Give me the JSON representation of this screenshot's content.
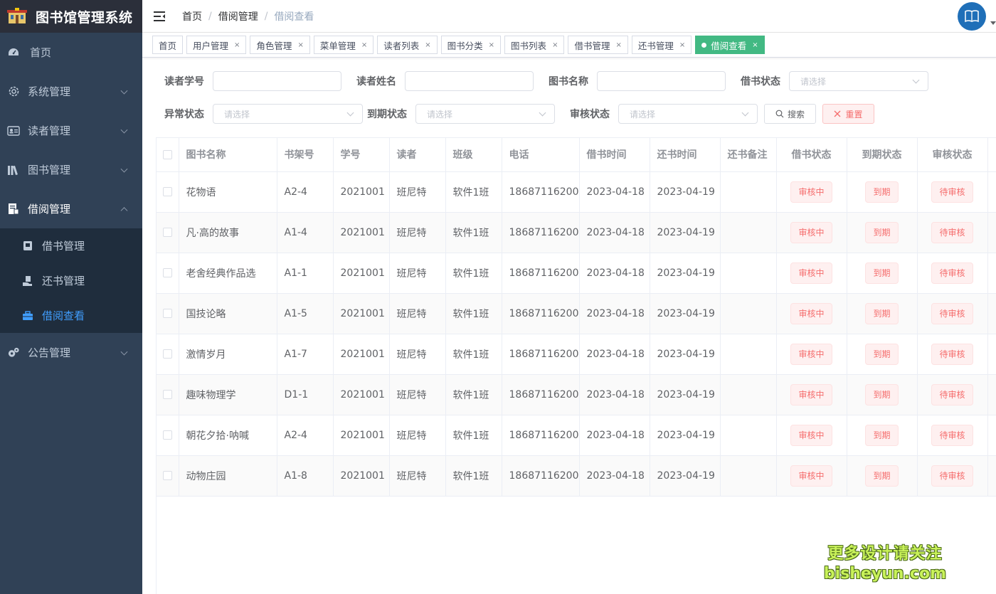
{
  "app": {
    "title": "图书馆管理系统"
  },
  "sidebar": {
    "items": [
      {
        "label": "首页",
        "icon": "dashboard-icon"
      },
      {
        "label": "系统管理",
        "icon": "gear-icon"
      },
      {
        "label": "读者管理",
        "icon": "id-card-icon"
      },
      {
        "label": "图书管理",
        "icon": "books-icon"
      },
      {
        "label": "借阅管理",
        "icon": "document-icon"
      },
      {
        "label": "公告管理",
        "icon": "cogs-icon"
      }
    ],
    "sub": [
      {
        "label": "借书管理",
        "icon": "book-icon"
      },
      {
        "label": "还书管理",
        "icon": "hand-icon"
      },
      {
        "label": "借阅查看",
        "icon": "briefcase-icon"
      }
    ]
  },
  "navbar": {
    "breadcrumb": [
      "首页",
      "借阅管理",
      "借阅查看"
    ],
    "sep": "/"
  },
  "tags": [
    {
      "label": "首页",
      "closable": false
    },
    {
      "label": "用户管理",
      "closable": true
    },
    {
      "label": "角色管理",
      "closable": true
    },
    {
      "label": "菜单管理",
      "closable": true
    },
    {
      "label": "读者列表",
      "closable": true
    },
    {
      "label": "图书分类",
      "closable": true
    },
    {
      "label": "图书列表",
      "closable": true
    },
    {
      "label": "借书管理",
      "closable": true
    },
    {
      "label": "还书管理",
      "closable": true
    },
    {
      "label": "借阅查看",
      "closable": true,
      "active": true
    }
  ],
  "close_glyph": "×",
  "form": {
    "reader_no": "读者学号",
    "reader_name": "读者姓名",
    "book_name": "图书名称",
    "borrow_status": "借书状态",
    "abnormal_status": "异常状态",
    "due_status": "到期状态",
    "audit_status": "审核状态",
    "placeholder": "请选择",
    "search_btn": "搜索",
    "reset_btn": "重置"
  },
  "table": {
    "headers": [
      "图书名称",
      "书架号",
      "学号",
      "读者",
      "班级",
      "电话",
      "借书时间",
      "还书时间",
      "还书备注",
      "借书状态",
      "到期状态",
      "审核状态"
    ],
    "rows": [
      {
        "book": "花物语",
        "shelf": "A2-4",
        "no": "2021001",
        "reader": "班尼特",
        "cls": "软件1班",
        "phone": "18687116200",
        "borrow": "2023-04-18",
        "ret": "2023-04-19",
        "note": "",
        "s1": "审核中",
        "s2": "到期",
        "s3": "待审核"
      },
      {
        "book": "凡·高的故事",
        "shelf": "A1-4",
        "no": "2021001",
        "reader": "班尼特",
        "cls": "软件1班",
        "phone": "18687116200",
        "borrow": "2023-04-18",
        "ret": "2023-04-19",
        "note": "",
        "s1": "审核中",
        "s2": "到期",
        "s3": "待审核"
      },
      {
        "book": "老舍经典作品选",
        "shelf": "A1-1",
        "no": "2021001",
        "reader": "班尼特",
        "cls": "软件1班",
        "phone": "18687116200",
        "borrow": "2023-04-18",
        "ret": "2023-04-19",
        "note": "",
        "s1": "审核中",
        "s2": "到期",
        "s3": "待审核"
      },
      {
        "book": "国技论略",
        "shelf": "A1-5",
        "no": "2021001",
        "reader": "班尼特",
        "cls": "软件1班",
        "phone": "18687116200",
        "borrow": "2023-04-18",
        "ret": "2023-04-19",
        "note": "",
        "s1": "审核中",
        "s2": "到期",
        "s3": "待审核"
      },
      {
        "book": "激情岁月",
        "shelf": "A1-7",
        "no": "2021001",
        "reader": "班尼特",
        "cls": "软件1班",
        "phone": "18687116200",
        "borrow": "2023-04-18",
        "ret": "2023-04-19",
        "note": "",
        "s1": "审核中",
        "s2": "到期",
        "s3": "待审核"
      },
      {
        "book": "趣味物理学",
        "shelf": "D1-1",
        "no": "2021001",
        "reader": "班尼特",
        "cls": "软件1班",
        "phone": "18687116200",
        "borrow": "2023-04-18",
        "ret": "2023-04-19",
        "note": "",
        "s1": "审核中",
        "s2": "到期",
        "s3": "待审核"
      },
      {
        "book": "朝花夕拾·呐喊",
        "shelf": "A2-4",
        "no": "2021001",
        "reader": "班尼特",
        "cls": "软件1班",
        "phone": "18687116200",
        "borrow": "2023-04-18",
        "ret": "2023-04-19",
        "note": "",
        "s1": "审核中",
        "s2": "到期",
        "s3": "待审核"
      },
      {
        "book": "动物庄园",
        "shelf": "A1-8",
        "no": "2021001",
        "reader": "班尼特",
        "cls": "软件1班",
        "phone": "18687116200",
        "borrow": "2023-04-18",
        "ret": "2023-04-19",
        "note": "",
        "s1": "审核中",
        "s2": "到期",
        "s3": "待审核"
      }
    ]
  },
  "watermark": {
    "line1": "更多设计请关注",
    "line2": "bisheyun.com"
  },
  "colors": {
    "sidebar": "#304156",
    "submenu": "#1f2d3d",
    "active": "#409eff",
    "tag_active": "#42b983",
    "danger": "#f56c6c"
  }
}
